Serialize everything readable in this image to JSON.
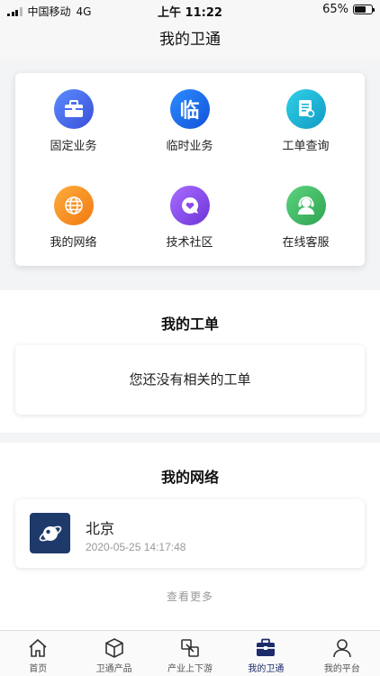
{
  "status_bar": {
    "carrier": "中国移动",
    "network": "4G",
    "time": "上午 11:22",
    "battery_percent": "65%",
    "battery_level": 0.65
  },
  "nav": {
    "title": "我的卫通"
  },
  "services": [
    {
      "label": "固定业务",
      "icon": "briefcase-icon",
      "color": "#4a6cf7"
    },
    {
      "label": "临时业务",
      "icon": "lin-char-icon",
      "color": "#1c6fe8",
      "glyph": "临"
    },
    {
      "label": "工单查询",
      "icon": "document-search-icon",
      "color": "#19b5d6"
    },
    {
      "label": "我的网络",
      "icon": "globe-icon",
      "color": "#f7931e"
    },
    {
      "label": "技术社区",
      "icon": "chat-heart-icon",
      "color": "#8c4ae8"
    },
    {
      "label": "在线客服",
      "icon": "headset-agent-icon",
      "color": "#3dbb68"
    }
  ],
  "tickets": {
    "title": "我的工单",
    "empty_text": "您还没有相关的工单"
  },
  "network": {
    "title": "我的网络",
    "item": {
      "name": "北京",
      "time": "2020-05-25 14:17:48",
      "icon": "satellite-planet-icon"
    },
    "more": "查看更多"
  },
  "tabs": [
    {
      "label": "首页",
      "icon": "home-icon",
      "active": false
    },
    {
      "label": "卫通产品",
      "icon": "box-icon",
      "active": false
    },
    {
      "label": "产业上下游",
      "icon": "chain-icon",
      "active": false
    },
    {
      "label": "我的卫通",
      "icon": "briefcase-icon",
      "active": true
    },
    {
      "label": "我的平台",
      "icon": "user-icon",
      "active": false
    }
  ],
  "colors": {
    "accent": "#1c2c6b"
  }
}
